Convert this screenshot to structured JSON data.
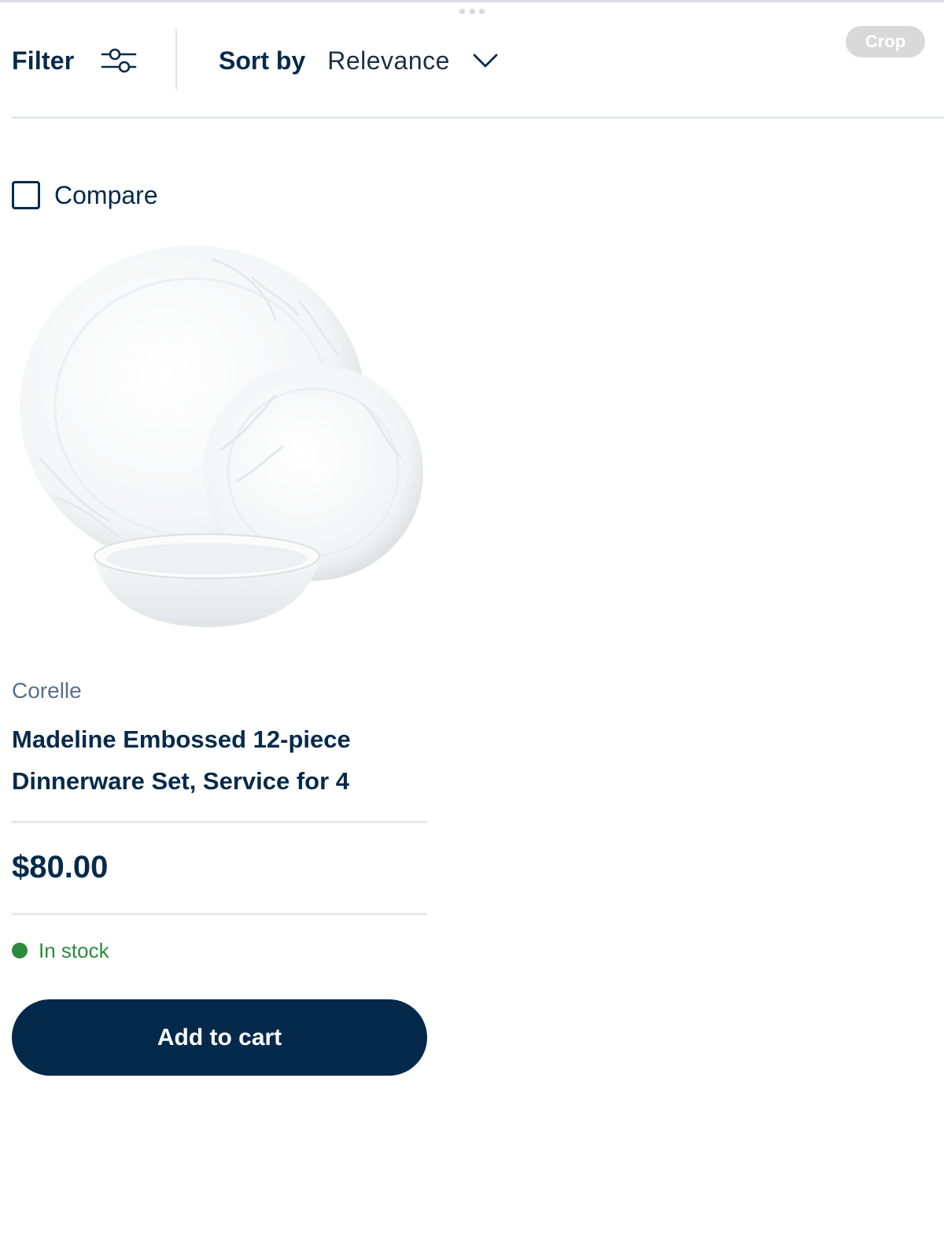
{
  "toolbar": {
    "filter_label": "Filter",
    "filter_icon": "sliders-icon",
    "sort_label": "Sort by",
    "sort_value": "Relevance",
    "sort_icon": "chevron-down-icon",
    "crop_label": "Crop"
  },
  "product": {
    "compare_label": "Compare",
    "compare_checked": false,
    "image_alt": "product-image",
    "brand": "Corelle",
    "title": "Madeline Embossed 12-piece Dinnerware Set, Service for 4",
    "price": "$80.00",
    "stock_label": "In stock",
    "add_to_cart_label": "Add to cart"
  },
  "colors": {
    "primary": "#04294a",
    "text_secondary": "#5a7087",
    "in_stock": "#2c8a3e",
    "divider": "#e4e7eb"
  }
}
